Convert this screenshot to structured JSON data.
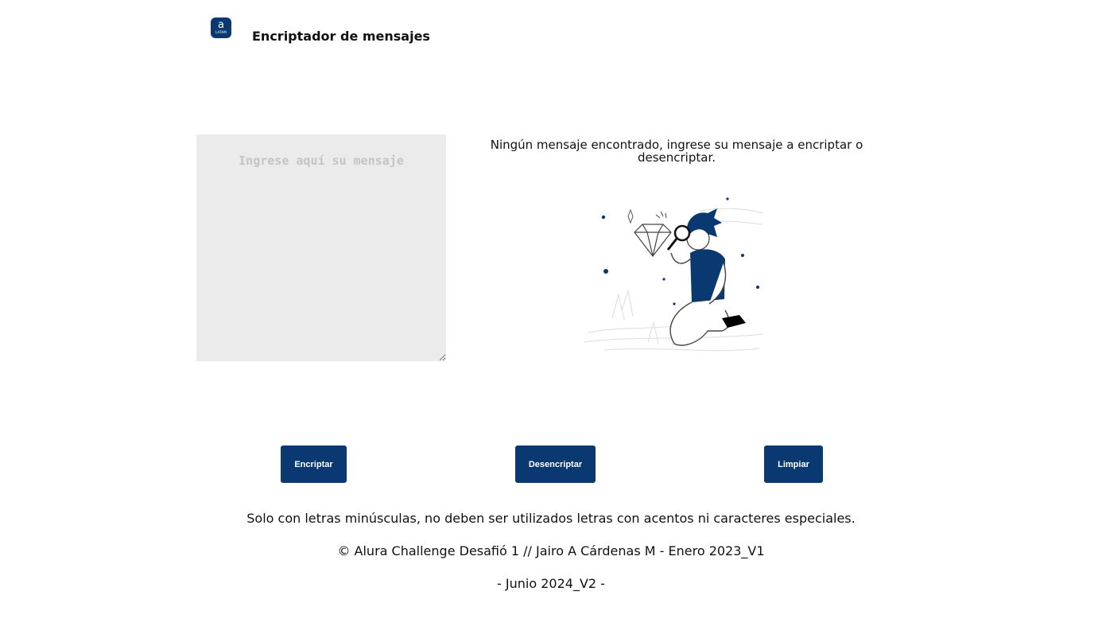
{
  "header": {
    "logo_letter": "a",
    "logo_sub": "LATAM",
    "title": "Encriptador de mensajes"
  },
  "input": {
    "placeholder": "Ingrese aquí su mensaje",
    "value": ""
  },
  "output": {
    "message": "Ningún mensaje encontrado, ingrese su mensaje a encriptar o desencriptar."
  },
  "buttons": {
    "encrypt_label": "Encriptar",
    "decrypt_label": "Desencriptar",
    "clear_label": "Limpiar"
  },
  "footer": {
    "note": "Solo con letras minúsculas, no deben ser utilizados letras con acentos ni caracteres especiales.",
    "credit": "© Alura Challenge Desafió 1 // Jairo A Cárdenas M - Enero 2023_V1",
    "version": "- Junio 2024_V2 -"
  },
  "colors": {
    "accent": "#0a3871",
    "input_bg": "#ebebeb",
    "placeholder": "#c4c4c4"
  },
  "icons": {
    "logo": "alura-latam-logo-icon",
    "illustration": "person-searching-diamond-illustration"
  }
}
